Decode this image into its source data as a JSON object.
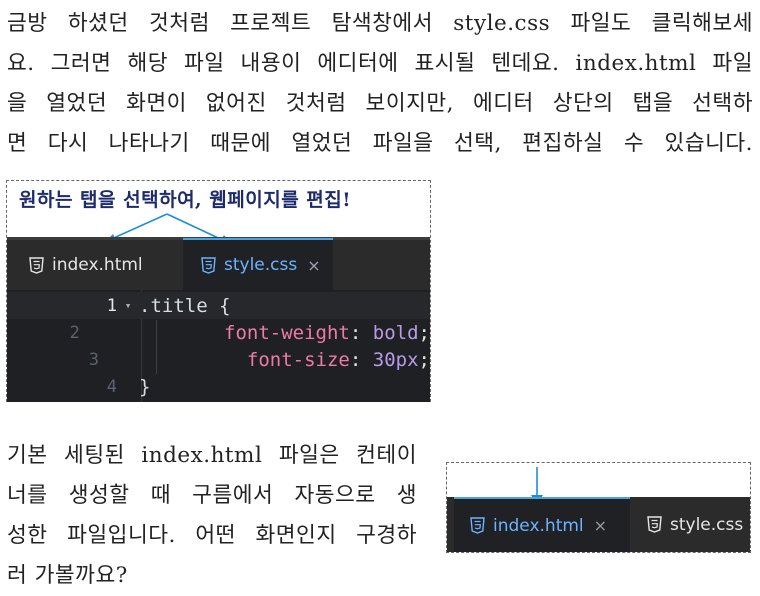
{
  "paragraph1": {
    "lines": [
      "금방 하셨던 것처럼 프로젝트 탐색창에서 style.css 파일도 클릭해보세",
      "요. 그러면 해당 파일 내용이 에디터에 표시될 텐데요. index.html 파일",
      "을 열었던 화면이 없어진 것처럼 보이지만, 에디터 상단의 탭을 선택하",
      "면 다시 나타나기 때문에 열었던 파일을 선택, 편집하실 수 있습니다."
    ]
  },
  "figure1": {
    "callout": "원하는 탭을 선택하여, 웹페이지를 편집!",
    "tabs": [
      {
        "label": "index.html",
        "active": false
      },
      {
        "label": "style.css",
        "active": true,
        "close": "×"
      }
    ],
    "code": {
      "line_numbers": [
        "1",
        "2",
        "3",
        "4"
      ],
      "fold_marker": "▾",
      "lines": [
        {
          "selector": ".title {"
        },
        {
          "property": "font-weight",
          "colon": ":",
          "value": "bold",
          "end": ";"
        },
        {
          "property": "font-size",
          "colon": ":",
          "value": "30px",
          "end": ";"
        },
        {
          "selector": "}"
        }
      ]
    }
  },
  "paragraph2": {
    "lines": [
      "기본 세팅된 index.html 파일은 컨테이",
      "너를 생성할 때 구름에서 자동으로 생",
      "성한 파일입니다. 어떤 화면인지 구경하",
      "러 가볼까요?"
    ]
  },
  "figure2": {
    "tabs": [
      {
        "label": "index.html",
        "active": true,
        "close": "×"
      },
      {
        "label": "style.css",
        "active": false
      }
    ]
  },
  "colors": {
    "accent": "#4aa3df",
    "active_tab_text": "#6eb3ff",
    "callout_text": "#1d2a6b",
    "arrow": "#1a8fd8",
    "editor_bg": "#1f2023",
    "css_property": "#ef7aa6",
    "css_value": "#b79be8"
  },
  "icons": {
    "file_icon": "html5-css3-file-icon",
    "close_icon": "close-icon",
    "fold_icon": "fold-arrow-icon"
  }
}
